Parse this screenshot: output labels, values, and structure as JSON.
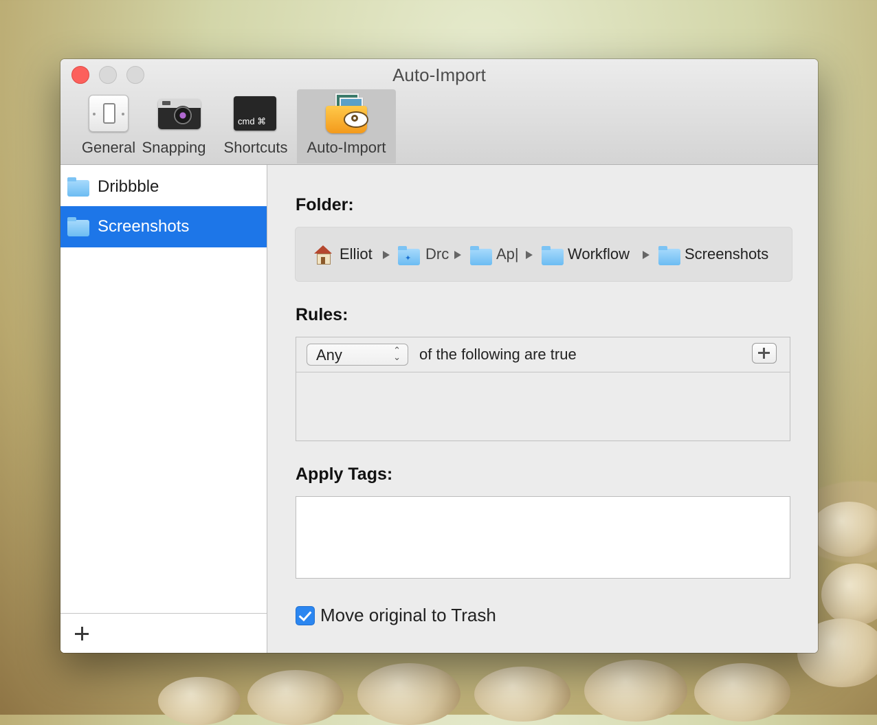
{
  "window": {
    "title": "Auto-Import"
  },
  "toolbar": {
    "items": [
      {
        "label": "General",
        "icon": "light-switch-icon"
      },
      {
        "label": "Snapping",
        "icon": "camera-icon"
      },
      {
        "label": "Shortcuts",
        "icon": "cmd-key-icon",
        "icon_text": "cmd  ⌘"
      },
      {
        "label": "Auto-Import",
        "icon": "folder-eye-icon",
        "selected": true
      }
    ]
  },
  "sidebar": {
    "items": [
      {
        "label": "Dribbble",
        "icon": "folder-icon",
        "selected": false
      },
      {
        "label": "Screenshots",
        "icon": "folder-icon",
        "selected": true
      }
    ],
    "selection_color": "#1d76e8"
  },
  "main": {
    "folder_title": "Folder:",
    "path": [
      {
        "label": "Elliot",
        "icon": "home-icon"
      },
      {
        "label": "Drc",
        "icon": "dropbox-folder-icon"
      },
      {
        "label": "Ap|",
        "icon": "folder-icon"
      },
      {
        "label": "Workflow",
        "icon": "folder-icon"
      },
      {
        "label": "Screenshots",
        "icon": "folder-icon"
      }
    ],
    "rules_title": "Rules:",
    "rules_match": "Any",
    "rules_text": "of the following are true",
    "tags_title": "Apply Tags:",
    "tags_value": "",
    "trash_label": "Move original to Trash",
    "trash_checked": true
  }
}
